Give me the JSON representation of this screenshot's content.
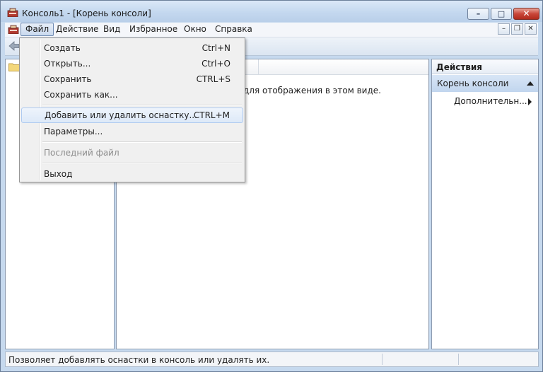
{
  "window": {
    "title": "Консоль1 - [Корень консоли]",
    "minimize_label": "–",
    "maximize_label": "□",
    "close_label": "✕"
  },
  "menubar": {
    "items": [
      "Файл",
      "Действие",
      "Вид",
      "Избранное",
      "Окно",
      "Справка"
    ],
    "active": "Файл",
    "mdi_minimize": "–",
    "mdi_restore": "❐",
    "mdi_close": "✕"
  },
  "file_menu": {
    "items": [
      {
        "label": "Создать",
        "shortcut": "Ctrl+N"
      },
      {
        "label": "Открыть...",
        "shortcut": "Ctrl+O"
      },
      {
        "label": "Сохранить",
        "shortcut": "CTRL+S"
      },
      {
        "label": "Сохранить как...",
        "shortcut": ""
      },
      {
        "label": "Добавить или удалить оснастку...",
        "shortcut": "CTRL+M",
        "highlighted": true
      },
      {
        "label": "Параметры...",
        "shortcut": ""
      },
      {
        "label": "Последний файл",
        "shortcut": "",
        "disabled": true
      },
      {
        "label": "Выход",
        "shortcut": ""
      }
    ]
  },
  "center": {
    "empty_message": "для отображения в этом виде."
  },
  "actions": {
    "title": "Действия",
    "section": "Корень консоли",
    "more": "Дополнительн..."
  },
  "status": {
    "text": "Позволяет добавлять оснастки в консоль или удалять их."
  },
  "colors": {
    "menu_highlight_border": "#aecaf0",
    "actions_section_bg": "#c8daf0",
    "window_frame": "#c6d9ee"
  }
}
